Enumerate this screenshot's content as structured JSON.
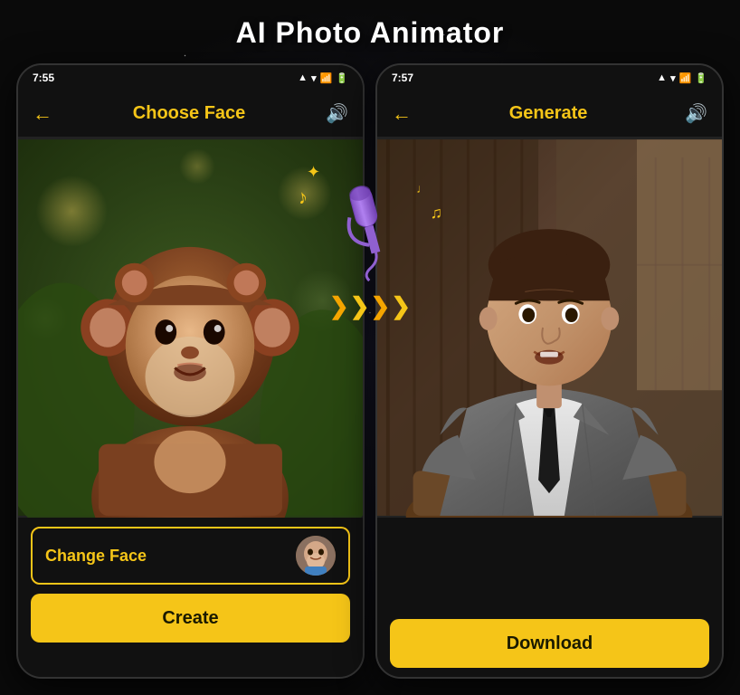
{
  "app": {
    "title": "AI Photo Animator",
    "background_color": "#0a0a0a"
  },
  "left_phone": {
    "status_bar": {
      "time": "7:55",
      "icons": [
        "signal",
        "wifi",
        "battery"
      ]
    },
    "header": {
      "back_label": "←",
      "title": "Choose Face",
      "sound_icon": "🔊"
    },
    "change_face_button": {
      "label": "Change Face"
    },
    "create_button": {
      "label": "Create"
    }
  },
  "right_phone": {
    "status_bar": {
      "time": "7:57",
      "icons": [
        "signal",
        "wifi",
        "battery"
      ]
    },
    "header": {
      "back_label": "←",
      "title": "Generate",
      "sound_icon": "🔊"
    },
    "download_button": {
      "label": "Download"
    }
  },
  "middle_decorations": {
    "sparkle": "✦",
    "music_note_1": "♪",
    "music_note_2": "♫",
    "music_note_3": "♩",
    "arrows": [
      "❯",
      "❯",
      "❯",
      "❯"
    ]
  }
}
